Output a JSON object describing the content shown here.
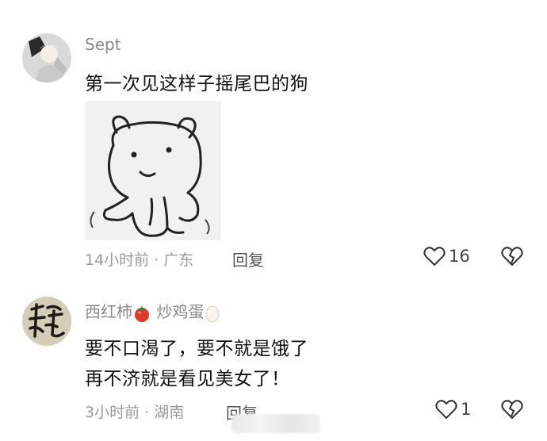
{
  "comments": [
    {
      "username": "Sept",
      "lines": [
        "第一次见这样子摇尾巴的狗"
      ],
      "time_location": "14小时前 · 广东",
      "reply_label": "回复",
      "like_count": "16",
      "has_sticker": true
    },
    {
      "username": "西红柿",
      "username_mid": "炒鸡蛋",
      "lines": [
        "要不口渴了，要不就是饿了",
        "再不济就是看见美女了！"
      ],
      "time_location": "3小时前 · 湖南",
      "reply_label": "回复",
      "like_count": "1"
    }
  ],
  "icons": {
    "like": "heart-outline-icon",
    "dislike": "broken-heart-icon",
    "tomato": "tomato-emoji",
    "egg": "egg-emoji"
  },
  "colors": {
    "meta_gray": "#9a9a9a",
    "tomato_red": "#e2382a"
  }
}
